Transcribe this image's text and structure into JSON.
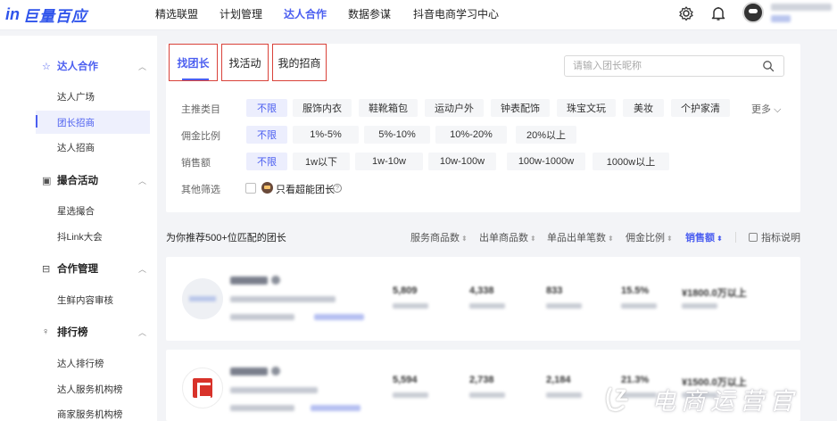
{
  "brand": {
    "logo_mark": "in",
    "logo_text": "巨量百应",
    "accent": "#4b5ef0"
  },
  "nav": {
    "items": [
      {
        "label": "精选联盟"
      },
      {
        "label": "计划管理"
      },
      {
        "label": "达人合作",
        "active": true
      },
      {
        "label": "数据参谋"
      },
      {
        "label": "抖音电商学习中心"
      }
    ],
    "icons": [
      "gear-icon",
      "bell-icon",
      "avatar"
    ]
  },
  "sidebar": {
    "groups": [
      {
        "label": "达人合作",
        "icon": "star-icon",
        "items": [
          "达人广场",
          "团长招商",
          "达人招商"
        ]
      },
      {
        "label": "撮合活动",
        "icon": "calendar-icon",
        "items": [
          "星选撮合",
          "抖Link大会"
        ]
      },
      {
        "label": "合作管理",
        "icon": "clipboard-icon",
        "items": [
          "生鲜内容审核"
        ]
      },
      {
        "label": "排行榜",
        "icon": "trophy-icon",
        "items": [
          "达人排行榜",
          "达人服务机构榜",
          "商家服务机构榜"
        ]
      }
    ],
    "active_item": "团长招商"
  },
  "tabs": [
    {
      "label": "找团长",
      "active": true
    },
    {
      "label": "找活动"
    },
    {
      "label": "我的招商"
    }
  ],
  "search": {
    "placeholder": "请输入团长昵称",
    "value": ""
  },
  "filters": {
    "category": {
      "label": "主推类目",
      "options": [
        "不限",
        "服饰内衣",
        "鞋靴箱包",
        "运动户外",
        "钟表配饰",
        "珠宝文玩",
        "美妆",
        "个护家清"
      ],
      "more": "更多"
    },
    "commission": {
      "label": "佣金比例",
      "options": [
        "不限",
        "1%-5%",
        "5%-10%",
        "10%-20%",
        "20%以上"
      ]
    },
    "sales": {
      "label": "销售额",
      "options": [
        "不限",
        "1w以下",
        "1w-10w",
        "10w-100w",
        "100w-1000w",
        "1000w以上"
      ]
    },
    "other": {
      "label": "其他筛选",
      "option": "只看超能团长",
      "checked": false
    }
  },
  "results": {
    "title": "为你推荐500+位匹配的团长",
    "sorts": [
      {
        "label": "服务商品数"
      },
      {
        "label": "出单商品数"
      },
      {
        "label": "单品出单笔数"
      },
      {
        "label": "佣金比例"
      },
      {
        "label": "销售额",
        "active": true
      }
    ],
    "indicator": "指标说明",
    "cards": [
      {
        "metrics": [
          "5,809",
          "4,338",
          "833",
          "15.5%",
          "¥1800.0万以上"
        ]
      },
      {
        "metrics": [
          "5,594",
          "2,738",
          "2,184",
          "21.3%",
          "¥1500.0万以上"
        ]
      }
    ]
  },
  "watermark": "电商运营官"
}
